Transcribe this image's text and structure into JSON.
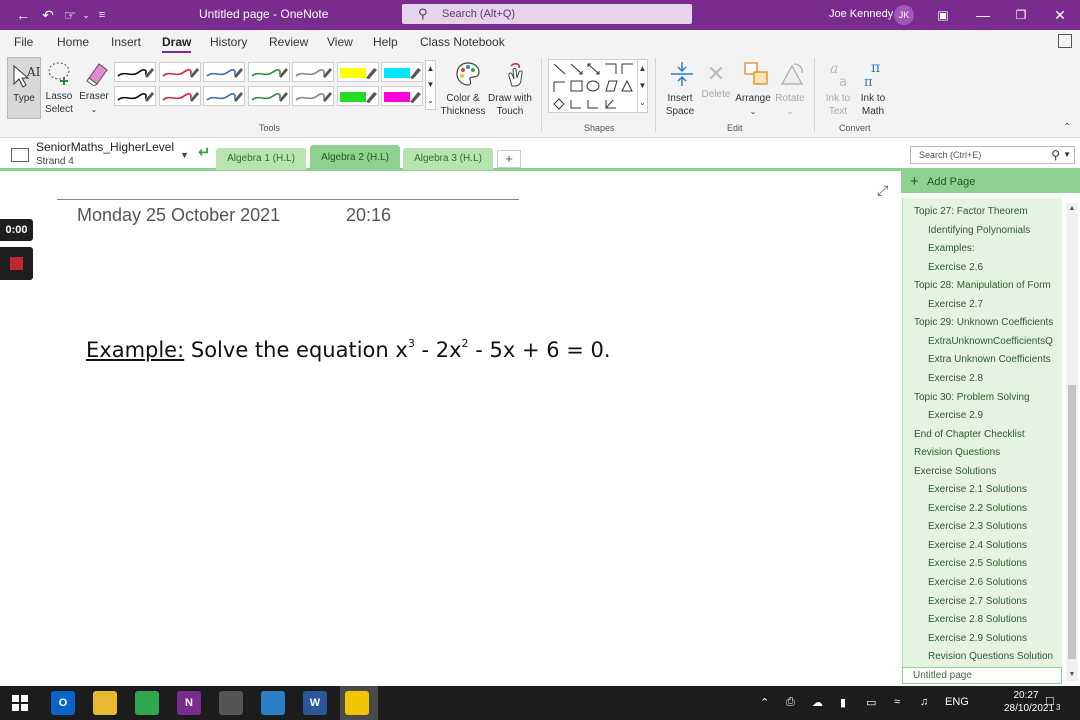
{
  "titlebar": {
    "title": "Untitled page  -  OneNote",
    "search_placeholder": "Search (Alt+Q)",
    "user_name": "Joe Kennedy",
    "user_initials": "JK"
  },
  "menu": [
    "File",
    "Home",
    "Insert",
    "Draw",
    "History",
    "Review",
    "View",
    "Help",
    "Class Notebook"
  ],
  "menu_active": "Draw",
  "ribbon": {
    "type_label": "Type",
    "lasso_label_1": "Lasso",
    "lasso_label_2": "Select",
    "eraser_label": "Eraser",
    "color_label_1": "Color &",
    "color_label_2": "Thickness",
    "draw_touch_1": "Draw with",
    "draw_touch_2": "Touch",
    "insert_space_1": "Insert",
    "insert_space_2": "Space",
    "delete_label": "Delete",
    "arrange_label": "Arrange",
    "rotate_label": "Rotate",
    "ink_text_1": "Ink to",
    "ink_text_2": "Text",
    "ink_math_1": "Ink to",
    "ink_math_2": "Math",
    "groups": {
      "tools": "Tools",
      "shapes": "Shapes",
      "edit": "Edit",
      "convert": "Convert"
    },
    "pens_row1": [
      "#111111",
      "#c8283c",
      "#3c6ac0",
      "#2e8a3e",
      "#888888",
      "#ffff00",
      "#00e5ff"
    ],
    "pens_row2": [
      "#111111",
      "#c8283c",
      "#3c6ac0",
      "#2e8a3e",
      "#888888",
      "#22dd22",
      "#ff00dd"
    ]
  },
  "notebook": {
    "name": "SeniorMaths_HigherLevel",
    "section": "Strand 4",
    "tabs": [
      "Algebra 1 (H.L)",
      "Algebra 2 (H.L)",
      "Algebra 3 (H.L)"
    ],
    "active_tab": "Algebra 2 (H.L)",
    "search_placeholder": "Search (Ctrl+E)"
  },
  "page": {
    "date": "Monday 25 October 2021",
    "time": "20:16",
    "example_label": "Example:",
    "example_text": "Solve the equation x",
    "exp1": "3",
    "mid": "- 2x",
    "exp2": "2",
    "tail": "- 5x + 6 = 0."
  },
  "recorder": {
    "timer": "0:00"
  },
  "pagelist": {
    "add_page": "Add Page",
    "pages": [
      {
        "label": "Topic 27: Factor Theorem",
        "indent": 0
      },
      {
        "label": "Identifying Polynomials",
        "indent": 1
      },
      {
        "label": "Examples:",
        "indent": 1
      },
      {
        "label": "Exercise 2.6",
        "indent": 1
      },
      {
        "label": "Topic 28: Manipulation of Form",
        "indent": 0
      },
      {
        "label": "Exercise 2.7",
        "indent": 1
      },
      {
        "label": "Topic 29: Unknown Coefficients",
        "indent": 0
      },
      {
        "label": "ExtraUnknownCoefficientsQ",
        "indent": 1
      },
      {
        "label": "Extra Unknown Coefficients",
        "indent": 1
      },
      {
        "label": "Exercise 2.8",
        "indent": 1
      },
      {
        "label": "Topic 30: Problem Solving",
        "indent": 0
      },
      {
        "label": "Exercise 2.9",
        "indent": 1
      },
      {
        "label": "End of Chapter Checklist",
        "indent": 0
      },
      {
        "label": "Revision Questions",
        "indent": 0
      },
      {
        "label": "Exercise Solutions",
        "indent": 0
      },
      {
        "label": "Exercise 2.1 Solutions",
        "indent": 1
      },
      {
        "label": "Exercise 2.2 Solutions",
        "indent": 1
      },
      {
        "label": "Exercise 2.3 Solutions",
        "indent": 1
      },
      {
        "label": "Exercise 2.4 Solutions",
        "indent": 1
      },
      {
        "label": "Exercise 2.5 Solutions",
        "indent": 1
      },
      {
        "label": "Exercise 2.6 Solutions",
        "indent": 1
      },
      {
        "label": "Exercise 2.7 Solutions",
        "indent": 1
      },
      {
        "label": "Exercise 2.8 Solutions",
        "indent": 1
      },
      {
        "label": "Exercise 2.9 Solutions",
        "indent": 1
      },
      {
        "label": "Revision Questions Solution",
        "indent": 1
      }
    ],
    "current_page": "Untitled page"
  },
  "taskbar": {
    "language": "ENG",
    "time": "20:27",
    "date": "28/10/2021",
    "notifications": "3",
    "apps": [
      {
        "name": "windows-start",
        "label": "",
        "color": "#1c1c1c"
      },
      {
        "name": "outlook",
        "label": "O",
        "color": "#0a64c8"
      },
      {
        "name": "file-explorer",
        "label": "",
        "color": "#e8b830"
      },
      {
        "name": "chrome",
        "label": "",
        "color": "#2fa84f"
      },
      {
        "name": "onenote",
        "label": "N",
        "color": "#7a2c8e"
      },
      {
        "name": "calculator",
        "label": "",
        "color": "#555555"
      },
      {
        "name": "remote-desktop",
        "label": "",
        "color": "#2a7fc4"
      },
      {
        "name": "word",
        "label": "W",
        "color": "#2b579a"
      },
      {
        "name": "sticky-notes",
        "label": "",
        "color": "#f2c300"
      }
    ]
  }
}
